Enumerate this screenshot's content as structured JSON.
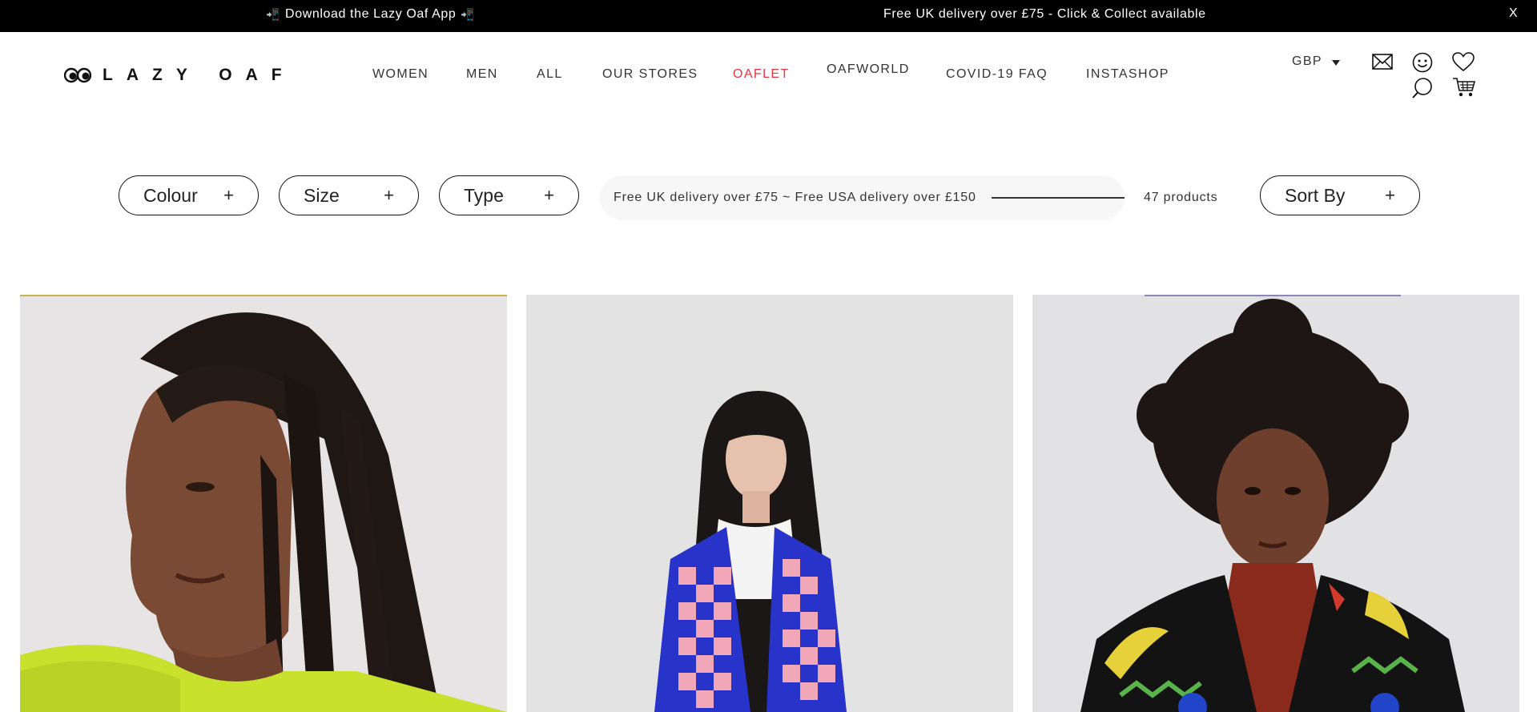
{
  "announcement": {
    "app_text": "Download the Lazy Oaf App",
    "delivery_text": "Free UK delivery over £75 - Click & Collect available",
    "close_label": "X"
  },
  "header": {
    "logo_text": "LAZY OAF",
    "nav": [
      "WOMEN",
      "MEN",
      "ALL",
      "OUR STORES",
      "OAFLET",
      "OAFWORLD",
      "COVID-19 FAQ",
      "INSTASHOP"
    ],
    "currency": "GBP",
    "icons": [
      "mail-icon",
      "account-icon",
      "wishlist-icon",
      "search-icon",
      "cart-icon"
    ]
  },
  "filters": {
    "colour": "Colour",
    "size": "Size",
    "type": "Type",
    "plus": "+",
    "sort": "Sort By"
  },
  "promo": {
    "text": "Free UK delivery over £75 ~ Free USA delivery over £150"
  },
  "product_count": "47 products",
  "products": [
    {
      "image": "model-lime-sweater"
    },
    {
      "image": "model-check-cardigan"
    },
    {
      "image": "model-banana-cardigan"
    }
  ],
  "colors": {
    "accent": "#e8343f",
    "announce_bg": "#000000",
    "text": "#333333",
    "promo_bg": "#f7f7f7"
  }
}
